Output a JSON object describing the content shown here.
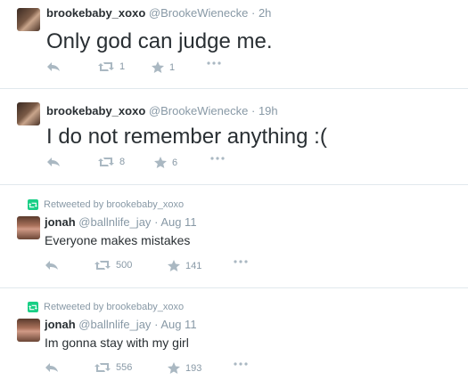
{
  "tweets": [
    {
      "name": "brookebaby_xoxo",
      "handle": "@BrookeWienecke",
      "sep": "·",
      "time": "2h",
      "text": "Only god can judge me.",
      "retweets": "1",
      "favorites": "1"
    },
    {
      "name": "brookebaby_xoxo",
      "handle": "@BrookeWienecke",
      "sep": "·",
      "time": "19h",
      "text": "I do not remember anything :(",
      "retweets": "8",
      "favorites": "6"
    },
    {
      "context": "Retweeted by brookebaby_xoxo",
      "name": "jonah",
      "handle": "@ballnlife_jay",
      "sep": "·",
      "time": "Aug 11",
      "text": "Everyone makes mistakes",
      "retweets": "500",
      "favorites": "141"
    },
    {
      "context": "Retweeted by brookebaby_xoxo",
      "name": "jonah",
      "handle": "@ballnlife_jay",
      "sep": "·",
      "time": "Aug 11",
      "text": "Im gonna stay with my girl",
      "retweets": "556",
      "favorites": "193"
    }
  ],
  "icons": {
    "reply": "reply-icon",
    "retweet": "retweet-icon",
    "favorite": "star-icon",
    "more": "more-icon"
  },
  "colors": {
    "text": "#292f33",
    "muted": "#8899a6",
    "retweet_green": "#19cf86",
    "divider": "#e1e8ed"
  }
}
